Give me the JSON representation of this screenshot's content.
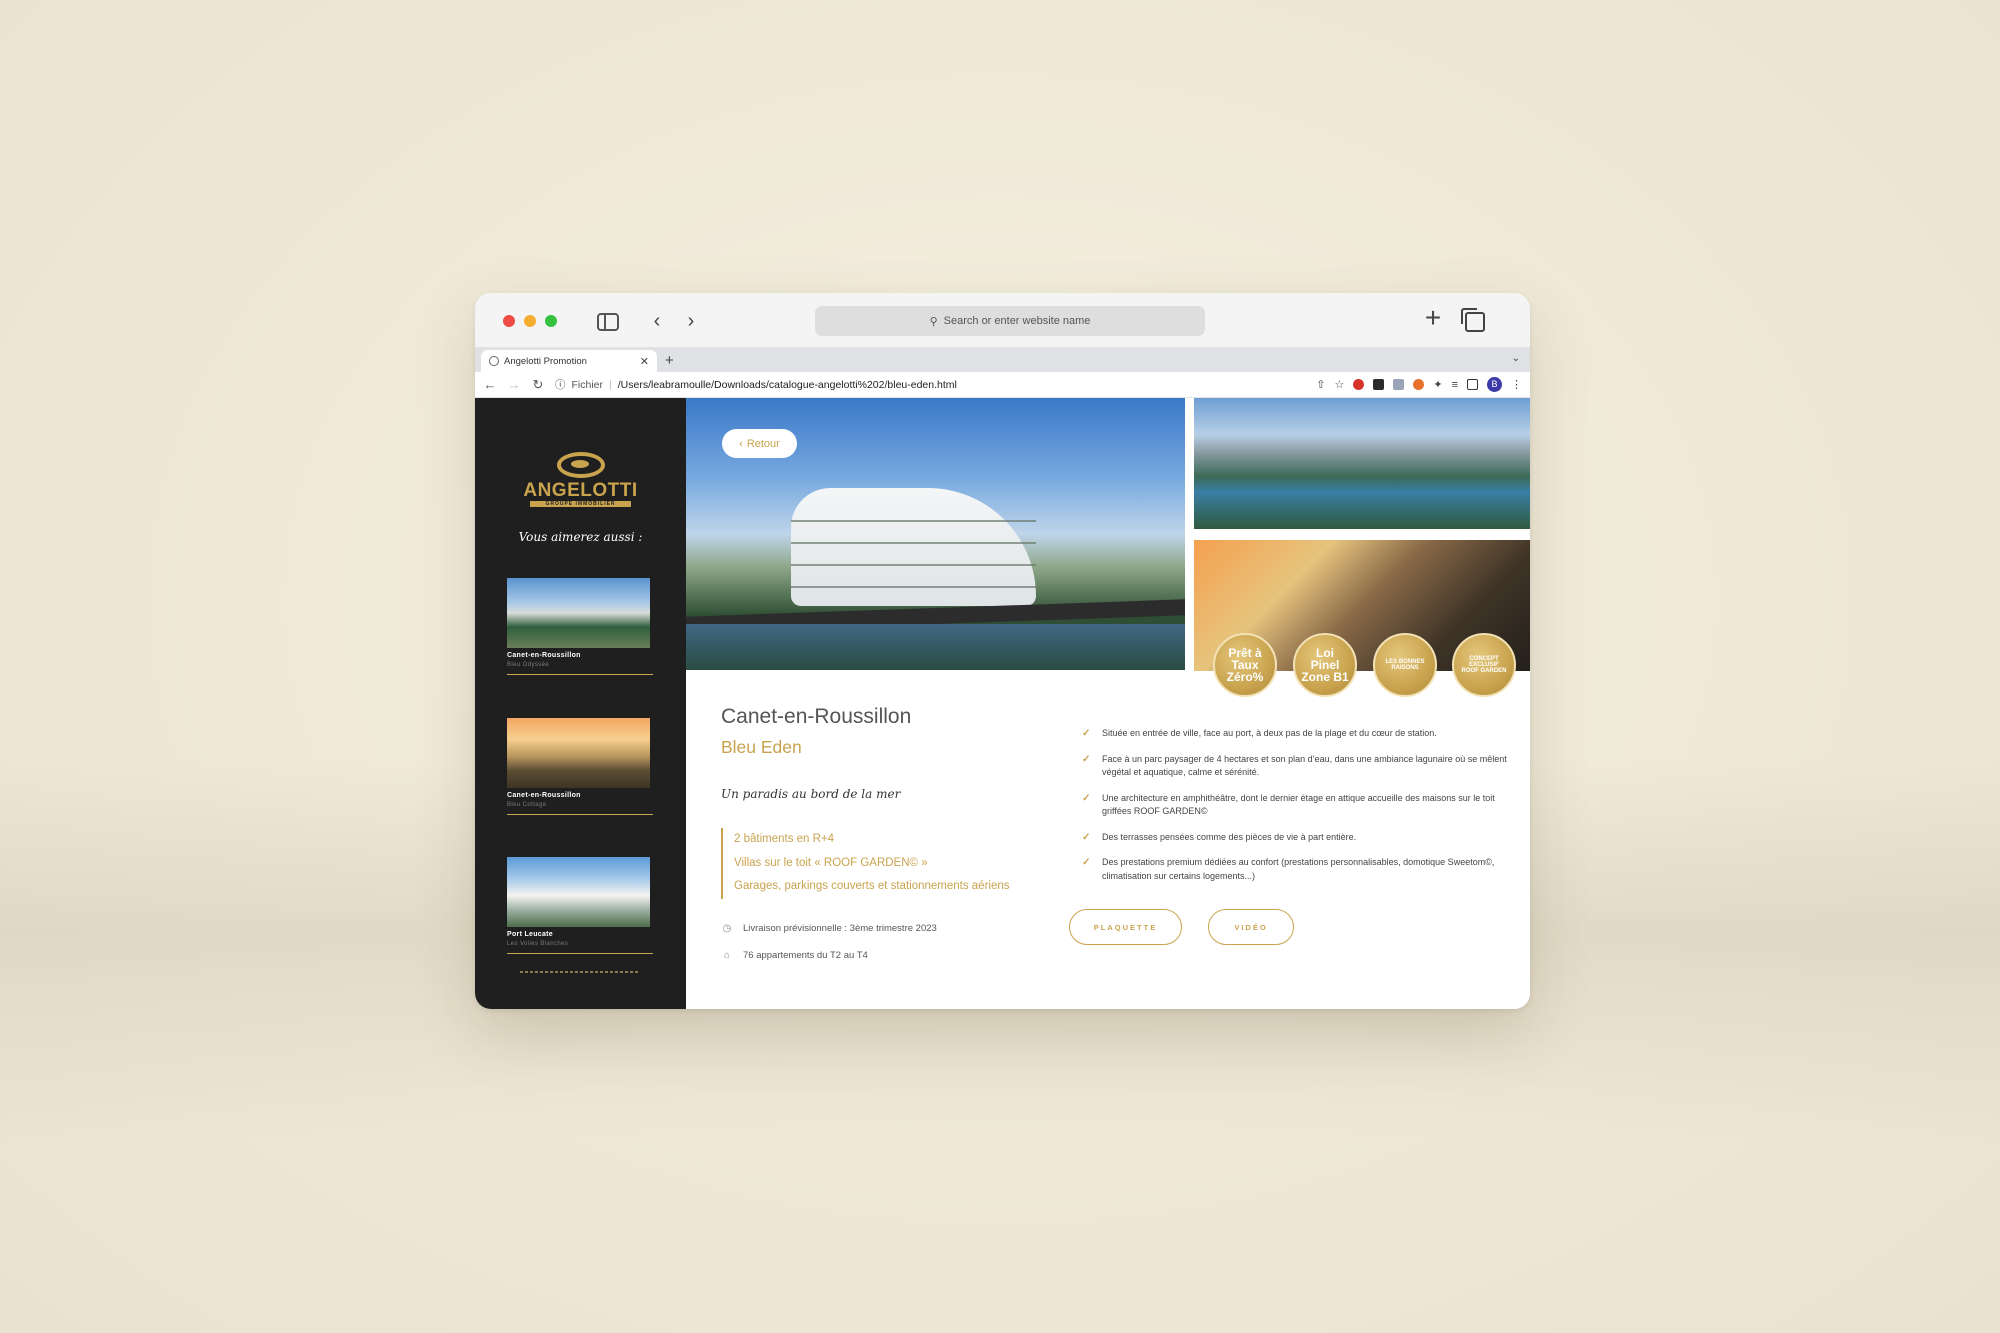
{
  "safari": {
    "address_placeholder": "Search or enter website name"
  },
  "browser": {
    "tab_title": "Angelotti Promotion",
    "url_scheme": "Fichier",
    "url_path": "/Users/leabramoulle/Downloads/catalogue-angelotti%202/bleu-eden.html",
    "profile_initial": "B"
  },
  "sidebar": {
    "logo_text": "ANGELOTTI",
    "logo_subtitle": "GROUPE IMMOBILIER",
    "heading": "Vous aimerez aussi :",
    "cards": [
      {
        "city": "Canet-en-Roussillon",
        "name": "Bleu Odyssée"
      },
      {
        "city": "Canet-en-Roussillon",
        "name": "Bleu Cottage"
      },
      {
        "city": "Port Leucate",
        "name": "Les Voiles Blanches"
      }
    ]
  },
  "hero": {
    "back_label": "Retour"
  },
  "badges": [
    {
      "label": "Prêt à Taux Zéro%"
    },
    {
      "label": "Loi Pinel Zone B1"
    },
    {
      "label": "LES BONNES RAISONS"
    },
    {
      "label": "CONCEPT EXCLUSIF ROOF GARDEN"
    }
  ],
  "programme": {
    "city": "Canet-en-Roussillon",
    "name": "Bleu Eden",
    "tagline": "Un paradis au bord de la mer",
    "features": [
      "2 bâtiments en R+4",
      "Villas sur le toit « ROOF GARDEN© »",
      "Garages, parkings couverts et stationnements aériens"
    ],
    "delivery": "Livraison prévisionnelle : 3ème trimestre 2023",
    "apartments": "76 appartements du T2 au T4"
  },
  "highlights": [
    "Située en entrée de ville, face au port, à deux pas de la plage et du cœur de station.",
    "Face à un parc paysager de 4 hectares et son plan d’eau, dans une ambiance lagunaire où se mêlent végétal et aquatique, calme et sérénité.",
    "Une architecture en amphithéâtre, dont le dernier étage en attique accueille des maisons sur le toit griffées ROOF GARDEN©",
    "Des terrasses pensées comme des pièces de vie à part entière.",
    "Des prestations premium dédiées au confort (prestations personnalisables, domotique Sweetom©, climatisation sur certains logements...)"
  ],
  "actions": {
    "plaquette": "PLAQUETTE",
    "video": "VIDÉO"
  },
  "colors": {
    "brand_gold": "#c9a34e",
    "sidebar_bg": "#1f1f1f"
  }
}
